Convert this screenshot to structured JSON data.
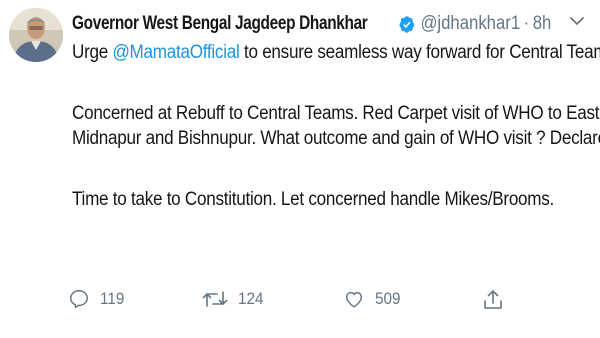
{
  "tweet": {
    "display_name": "Governor West Bengal Jagdeep Dhankhar",
    "handle": "@jdhankhar1",
    "separator": "·",
    "time": "8h",
    "text": {
      "line1_prefix": "Urge ",
      "line1_mention": "@MamataOfficial",
      "line1_suffix": " to ensure seamless way forward for Central Teams.",
      "line2": "Concerned at Rebuff to Central Teams. Red Carpet visit of WHO to East",
      "line3": "Midnapur and Bishnupur. What outcome and gain of WHO visit ? Declare !",
      "line4": "Time to take to Constitution. Let concerned handle Mikes/Brooms."
    },
    "actions": {
      "reply_count": "119",
      "retweet_count": "124",
      "like_count": "509"
    }
  },
  "colors": {
    "link": "#1b95e0",
    "muted": "#657786",
    "text": "#14171a",
    "verified": "#1da1f2"
  },
  "icons": {
    "avatar": "avatar",
    "verified": "verified-badge-icon",
    "caret": "chevron-down-icon",
    "reply": "reply-icon",
    "retweet": "retweet-icon",
    "like": "heart-icon",
    "share": "share-icon"
  }
}
